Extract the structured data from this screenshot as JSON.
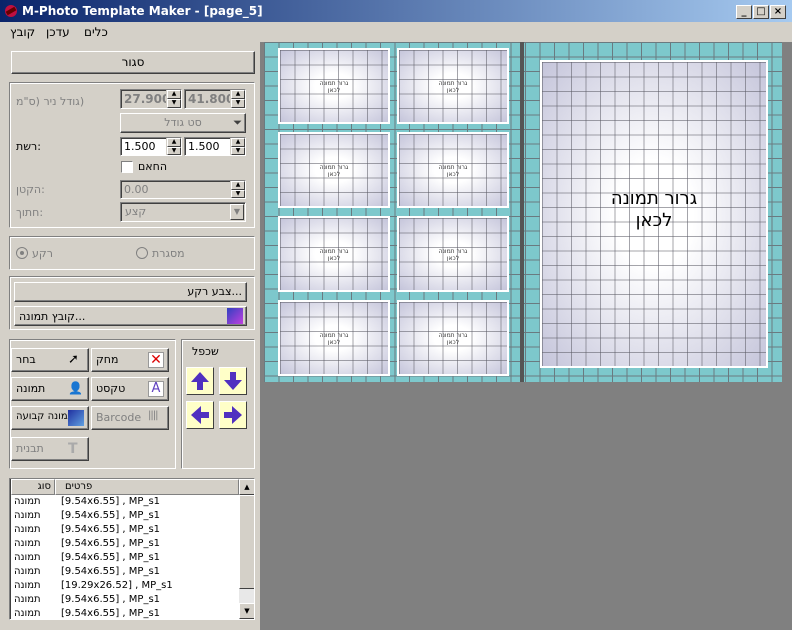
{
  "window": {
    "title": "M-Photo Template Maker - [page_5]",
    "min": "_",
    "max": "□",
    "close": "×"
  },
  "menu": {
    "items": [
      "קובץ",
      "עדכן",
      "כלים"
    ]
  },
  "left": {
    "close_button": "סגור",
    "paper_size_label": "(גודל ניר (ס\"מ",
    "paper_width": "27.900",
    "paper_height": "41.800",
    "size_set_select": "סט גודל",
    "grid_label": ":רשת",
    "grid_x": "1.500",
    "grid_y": "1.500",
    "snap_label": "החאם",
    "zoom_label": ":הקטן",
    "zoom_value": "0.00",
    "cut_label": ":חתוך",
    "cut_value": "קצע",
    "radio_background": "רקע",
    "radio_frame": "מסגרת",
    "bg_color_button": "...צבע רקע",
    "image_file_button": "...קובץ תמונה",
    "tools": {
      "select": "בחר",
      "delete": "מחק",
      "image": "תמונה",
      "text": "טקסט",
      "fixed_image": "תמונה קבועה",
      "barcode": "Barcode",
      "template": "תבנית"
    },
    "duplicate_label": "שכפל"
  },
  "list": {
    "headers": {
      "type": "סוג",
      "details": "פרטים"
    },
    "rows": [
      {
        "type": "תמונה",
        "details": "[9.54x6.55] , MP_s1"
      },
      {
        "type": "תמונה",
        "details": "[9.54x6.55] , MP_s1"
      },
      {
        "type": "תמונה",
        "details": "[9.54x6.55] , MP_s1"
      },
      {
        "type": "תמונה",
        "details": "[9.54x6.55] , MP_s1"
      },
      {
        "type": "תמונה",
        "details": "[9.54x6.55] , MP_s1"
      },
      {
        "type": "תמונה",
        "details": "[9.54x6.55] , MP_s1"
      },
      {
        "type": "תמונה",
        "details": "[19.29x26.52] , MP_s1"
      },
      {
        "type": "תמונה",
        "details": "[9.54x6.55] , MP_s1"
      },
      {
        "type": "תמונה",
        "details": "[9.54x6.55] , MP_s1"
      }
    ]
  },
  "canvas": {
    "small_slot_text_1": "גרור תמונה",
    "small_slot_text_2": "לכאן",
    "big_slot_text_1": "גרור תמונה",
    "big_slot_text_2": "לכאן"
  },
  "colors": {
    "title_start": "#0a246a",
    "title_end": "#a6caf0",
    "paper": "#7dc8cc",
    "canvas_bg": "#808080"
  }
}
